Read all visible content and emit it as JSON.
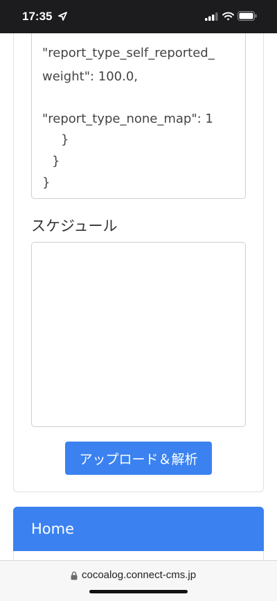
{
  "status_bar": {
    "time": "17:35"
  },
  "json_preview": {
    "lines": [
      "\"report_type_self_reported_",
      "weight\": 100.0,",
      "\"report_type_none_map\": 1",
      "}",
      "}",
      "}"
    ]
  },
  "schedule": {
    "label": "スケジュール",
    "value": ""
  },
  "upload_button": {
    "label": "アップロード＆解析"
  },
  "home_panel": {
    "title": "Home"
  },
  "browser": {
    "url": "cocoalog.connect-cms.jp"
  },
  "colors": {
    "accent": "#3b82f0",
    "status_bar": "#1c1c1e"
  }
}
